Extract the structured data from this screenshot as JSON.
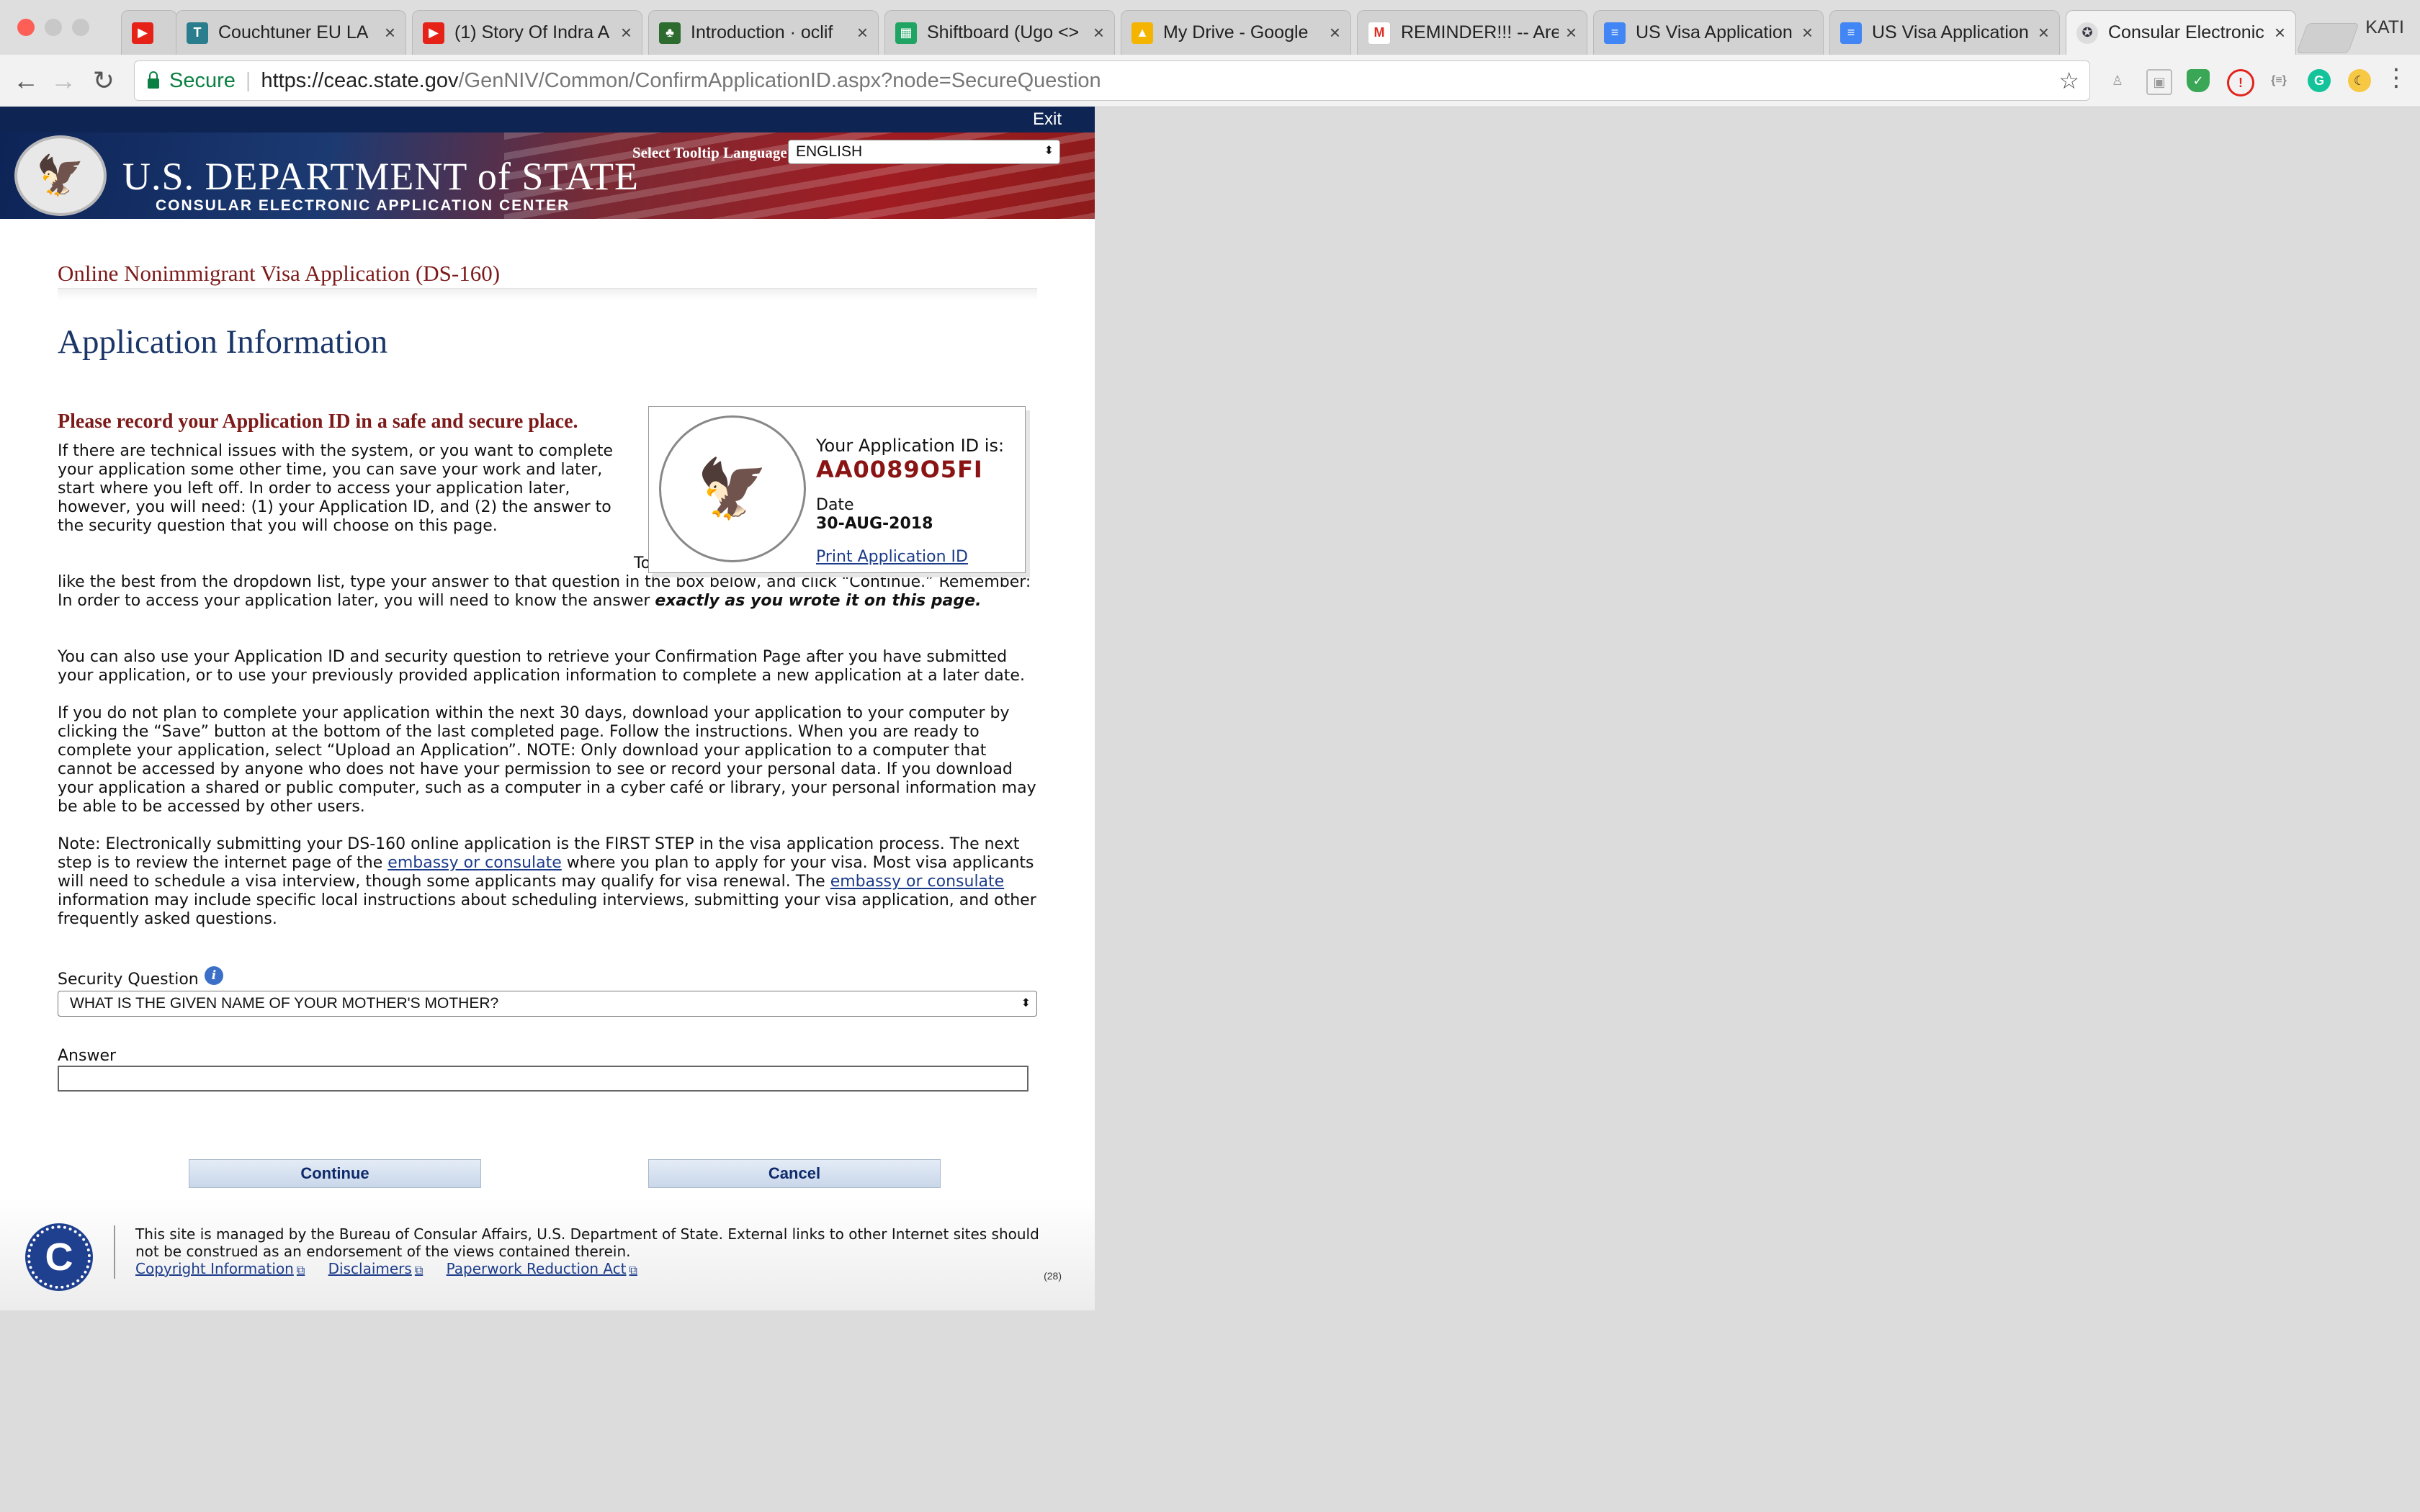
{
  "browser": {
    "tabs": [
      {
        "label": "",
        "icon": "youtube-icon"
      },
      {
        "label": "Couchtuner EU LA",
        "icon": "couchtuner-icon"
      },
      {
        "label": "(1) Story Of Indra A",
        "icon": "youtube-icon"
      },
      {
        "label": "Introduction · oclif",
        "icon": "oclif-icon"
      },
      {
        "label": "Shiftboard (Ugo <>",
        "icon": "sheets-icon"
      },
      {
        "label": "My Drive - Google",
        "icon": "drive-icon"
      },
      {
        "label": "REMINDER!!! -- Are",
        "icon": "gmail-icon"
      },
      {
        "label": "US Visa Application",
        "icon": "docs-icon"
      },
      {
        "label": "US Visa Application",
        "icon": "docs-icon"
      },
      {
        "label": "Consular Electronic",
        "icon": "state-seal-icon"
      }
    ],
    "profile": "KATI",
    "secure_label": "Secure",
    "url_host": "https://ceac.state.gov",
    "url_path": "/GenNIV/Common/ConfirmApplicationID.aspx?node=SecureQuestion"
  },
  "header": {
    "exit": "Exit",
    "dept_title": "U.S. DEPARTMENT of STATE",
    "dept_subtitle": "CONSULAR ELECTRONIC APPLICATION CENTER",
    "tooltip_language_label": "Select Tooltip Language",
    "tooltip_language_value": "ENGLISH"
  },
  "main": {
    "app_heading": "Online Nonimmigrant Visa Application (DS-160)",
    "page_title": "Application Information",
    "record_heading": "Please record your Application ID in a safe and secure place.",
    "para1": "If there are technical issues with the system, or you want to complete your application some other time, you can save your work and later, start where you left off. In order to access your application later, however, you will need: (1) your Application ID, and (2) the answer to the security question that you will choose on this page.",
    "para2_a": "To choose a security question, pick the one you like the best from the dropdown list, type your answer to that question in the box below, and click “Continue.” Remember: In order to access your application later, you will need to know the answer ",
    "para2_b": "exactly as you wrote it on this page.",
    "para3": "You can also use your Application ID and security question to retrieve your Confirmation Page after you have submitted your application, or to use your previously provided application information to complete a new application at a later date.",
    "para4": "If you do not plan to complete your application within the next 30 days, download your application to your computer by clicking the “Save” button at the bottom of the last completed page. Follow the instructions. When you are ready to complete your application, select “Upload an Application”. NOTE: Only download your application to a computer that cannot be accessed by anyone who does not have your permission to see or record your personal data. If you download your application a shared or public computer, such as a computer in a cyber café or library, your personal information may be able to be accessed by other users.",
    "para5_a": "Note: Electronically submitting your DS-160 online application is the FIRST STEP in the visa application process. The next step is to review the internet page of the ",
    "para5_link1": "embassy or consulate",
    "para5_b": " where you plan to apply for your visa. Most visa applicants will need to schedule a visa interview, though some applicants may qualify for visa renewal. The ",
    "para5_link2": "embassy or consulate",
    "para5_c": " information may include specific local instructions about scheduling interviews, submitting your visa application, and other frequently asked questions."
  },
  "idbox": {
    "label": "Your Application ID is:",
    "application_id": "AA0089O5FI",
    "date_label": "Date",
    "date_value": "30-AUG-2018",
    "print_link": "Print Application ID"
  },
  "form": {
    "security_question_label": "Security Question",
    "security_question_value": "WHAT IS THE GIVEN NAME OF YOUR MOTHER'S MOTHER?",
    "answer_label": "Answer",
    "answer_value": "",
    "continue_label": "Continue",
    "cancel_label": "Cancel"
  },
  "footer": {
    "text": "This site is managed by the Bureau of Consular Affairs, U.S. Department of State. External links to other Internet sites should not be construed as an endorsement of the views contained therein.",
    "links": [
      "Copyright Information",
      "Disclaimers",
      "Paperwork Reduction Act"
    ],
    "counter": "(28)"
  }
}
